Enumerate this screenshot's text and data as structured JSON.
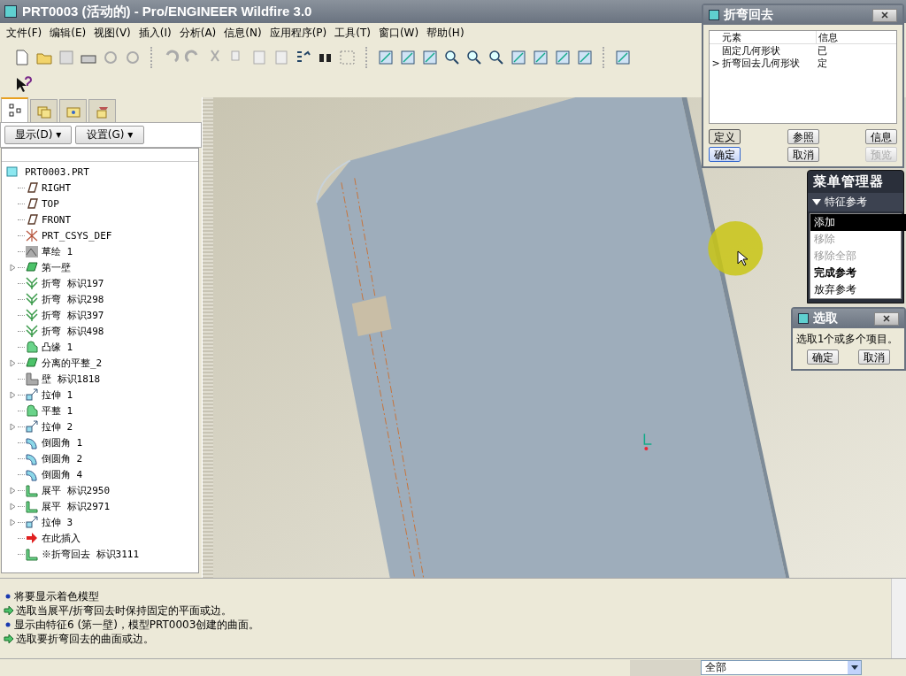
{
  "window": {
    "title": "PRT0003 (活动的) - Pro/ENGINEER Wildfire 3.0"
  },
  "menu": [
    "文件(F)",
    "编辑(E)",
    "视图(V)",
    "插入(I)",
    "分析(A)",
    "信息(N)",
    "应用程序(P)",
    "工具(T)",
    "窗口(W)",
    "帮助(H)"
  ],
  "panel_tabs": [
    {
      "kind": "tree",
      "selected": true
    },
    {
      "kind": "folders",
      "selected": false
    },
    {
      "kind": "favorites",
      "selected": false
    },
    {
      "kind": "tools",
      "selected": false
    }
  ],
  "panel_buttons": [
    "显示(D) ▾",
    "设置(G) ▾"
  ],
  "model_tree": {
    "root": "PRT0003.PRT",
    "items": [
      {
        "label": "RIGHT",
        "kind": "plane",
        "expandable": false
      },
      {
        "label": "TOP",
        "kind": "plane",
        "expandable": false
      },
      {
        "label": "FRONT",
        "kind": "plane",
        "expandable": false
      },
      {
        "label": "PRT_CSYS_DEF",
        "kind": "csys",
        "expandable": false
      },
      {
        "label": "草绘 1",
        "kind": "sketch",
        "expandable": false
      },
      {
        "label": "第一壁",
        "kind": "wall",
        "expandable": true
      },
      {
        "label": "折弯 标识197",
        "kind": "bend",
        "expandable": false
      },
      {
        "label": "折弯 标识298",
        "kind": "bend",
        "expandable": false
      },
      {
        "label": "折弯 标识397",
        "kind": "bend",
        "expandable": false
      },
      {
        "label": "折弯 标识498",
        "kind": "bend",
        "expandable": false
      },
      {
        "label": "凸缘 1",
        "kind": "flange",
        "expandable": false
      },
      {
        "label": "分离的平整_2",
        "kind": "wall",
        "expandable": true
      },
      {
        "label": "壁 标识1818",
        "kind": "flatwall",
        "expandable": false
      },
      {
        "label": "拉伸 1",
        "kind": "extrude",
        "expandable": true
      },
      {
        "label": "平整 1",
        "kind": "flange",
        "expandable": false
      },
      {
        "label": "拉伸 2",
        "kind": "extrude",
        "expandable": true
      },
      {
        "label": "倒圆角 1",
        "kind": "round",
        "expandable": false
      },
      {
        "label": "倒圆角 2",
        "kind": "round",
        "expandable": false
      },
      {
        "label": "倒圆角 4",
        "kind": "round",
        "expandable": false
      },
      {
        "label": "展平 标识2950",
        "kind": "unbend",
        "expandable": true
      },
      {
        "label": "展平 标识2971",
        "kind": "unbend",
        "expandable": true
      },
      {
        "label": "拉伸 3",
        "kind": "extrude",
        "expandable": true
      },
      {
        "label": "在此插入",
        "kind": "insert",
        "expandable": false
      },
      {
        "label": "※折弯回去 标识3111",
        "kind": "unbend",
        "expandable": false
      }
    ]
  },
  "bend_back_dialog": {
    "title": "折弯回去",
    "columns": [
      "元素",
      "信息"
    ],
    "rows": [
      {
        "marker": "",
        "element": "固定几何形状",
        "info": "已"
      },
      {
        "marker": ">",
        "element": "折弯回去几何形状",
        "info": "定"
      }
    ],
    "buttons": [
      {
        "label": "定义",
        "pressed": true,
        "default": false,
        "disabled": false
      },
      {
        "label": "参照",
        "pressed": false,
        "default": false,
        "disabled": false
      },
      {
        "label": "信息",
        "pressed": false,
        "default": false,
        "disabled": false
      },
      {
        "label": "确定",
        "pressed": false,
        "default": true,
        "disabled": false
      },
      {
        "label": "取消",
        "pressed": false,
        "default": false,
        "disabled": false
      },
      {
        "label": "预览",
        "pressed": false,
        "default": false,
        "disabled": true
      }
    ]
  },
  "menu_manager": {
    "title": "菜单管理器",
    "section": "特征参考",
    "items": [
      {
        "label": "添加",
        "selected": true,
        "disabled": false,
        "default": false
      },
      {
        "label": "移除",
        "selected": false,
        "disabled": true,
        "default": false
      },
      {
        "label": "移除全部",
        "selected": false,
        "disabled": true,
        "default": false
      },
      {
        "label": "完成参考",
        "selected": false,
        "disabled": false,
        "default": true
      },
      {
        "label": "放弃参考",
        "selected": false,
        "disabled": false,
        "default": false
      }
    ]
  },
  "select_dialog": {
    "title": "选取",
    "prompt": "选取1个或多个项目。",
    "buttons": [
      "确定",
      "取消"
    ]
  },
  "messages": [
    {
      "kind": "info",
      "text": "将要显示着色模型"
    },
    {
      "kind": "prompt",
      "text": "选取当展平/折弯回去时保持固定的平面或边。"
    },
    {
      "kind": "info",
      "text": "显示由特征6 (第一壁)，模型PRT0003创建的曲面。"
    },
    {
      "kind": "prompt",
      "text": "选取要折弯回去的曲面或边。"
    }
  ],
  "status_bar": {
    "filter": "全部"
  }
}
